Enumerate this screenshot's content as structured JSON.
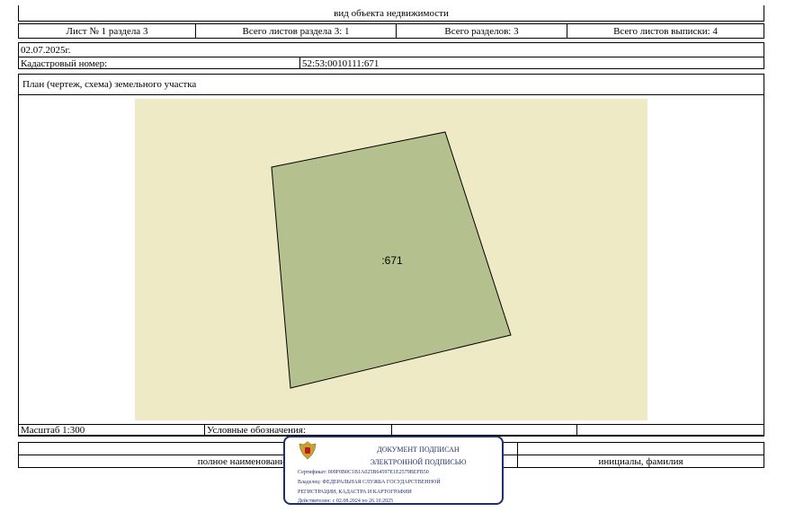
{
  "header": {
    "object_type": "вид объекта недвижимости",
    "sheet_of_section": "Лист № 1 раздела 3",
    "total_sheets_section": "Всего листов раздела 3: 1",
    "total_sections": "Всего разделов: 3",
    "total_sheets_extract": "Всего листов выписки: 4"
  },
  "info": {
    "date": "02.07.2025г.",
    "cadastral_label": "Кадастровый номер:",
    "cadastral_number": "52:53:0010111:671"
  },
  "plan": {
    "title": "План (чертеж, схема) земельного участка",
    "parcel_label": ":671",
    "colors": {
      "background": "#eeeac5",
      "parcel": "#b5c08f",
      "outline": "#000000"
    }
  },
  "legend_row": {
    "scale": "Масштаб 1:300",
    "legend_label": "Условные обозначения:"
  },
  "signature_row": {
    "position": "полное наименование должности",
    "initials": "инициалы, фамилия"
  },
  "stamp": {
    "line1": "ДОКУМЕНТ ПОДПИСАН",
    "line2": "ЭЛЕКТРОННОЙ ПОДПИСЬЮ",
    "certificate": "Сертификат: 009F0B0C1B1A025B64597E1E2579BEFB50",
    "owner_line1": "Владелец: ФЕДЕРАЛЬНАЯ СЛУЖБА ГОСУДАРСТВЕННОЙ",
    "owner_line2": "РЕГИСТРАЦИИ, КАДАСТРА И КАРТОГРАФИИ",
    "validity": "Действителен: с 02.08.2024 по 26.10.2025",
    "color": "#1f2f6e",
    "emblem": "coat-of-arms-emblem"
  }
}
